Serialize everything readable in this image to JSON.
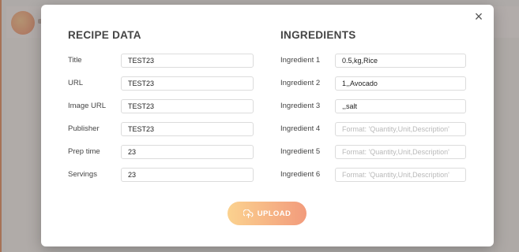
{
  "modal": {
    "close_label": "×",
    "recipe": {
      "title": "RECIPE DATA",
      "fields": [
        {
          "label": "Title",
          "value": "TEST23",
          "placeholder": ""
        },
        {
          "label": "URL",
          "value": "TEST23",
          "placeholder": ""
        },
        {
          "label": "Image URL",
          "value": "TEST23",
          "placeholder": ""
        },
        {
          "label": "Publisher",
          "value": "TEST23",
          "placeholder": ""
        },
        {
          "label": "Prep time",
          "value": "23",
          "placeholder": ""
        },
        {
          "label": "Servings",
          "value": "23",
          "placeholder": ""
        }
      ]
    },
    "ingredients": {
      "title": "INGREDIENTS",
      "fields": [
        {
          "label": "Ingredient 1",
          "value": "0.5,kg,Rice",
          "placeholder": "Format: 'Quantity,Unit,Description'"
        },
        {
          "label": "Ingredient 2",
          "value": "1,,Avocado",
          "placeholder": "Format: 'Quantity,Unit,Description'"
        },
        {
          "label": "Ingredient 3",
          "value": ",,salt",
          "placeholder": "Format: 'Quantity,Unit,Description'"
        },
        {
          "label": "Ingredient 4",
          "value": "",
          "placeholder": "Format: 'Quantity,Unit,Description'"
        },
        {
          "label": "Ingredient 5",
          "value": "",
          "placeholder": "Format: 'Quantity,Unit,Description'"
        },
        {
          "label": "Ingredient 6",
          "value": "",
          "placeholder": "Format: 'Quantity,Unit,Description'"
        }
      ]
    },
    "upload_label": "UPLOAD",
    "upload_icon": "upload-cloud-icon"
  },
  "colors": {
    "accent_start": "#fbd28f",
    "accent_end": "#f29b7c",
    "overlay": "#5a5552"
  }
}
